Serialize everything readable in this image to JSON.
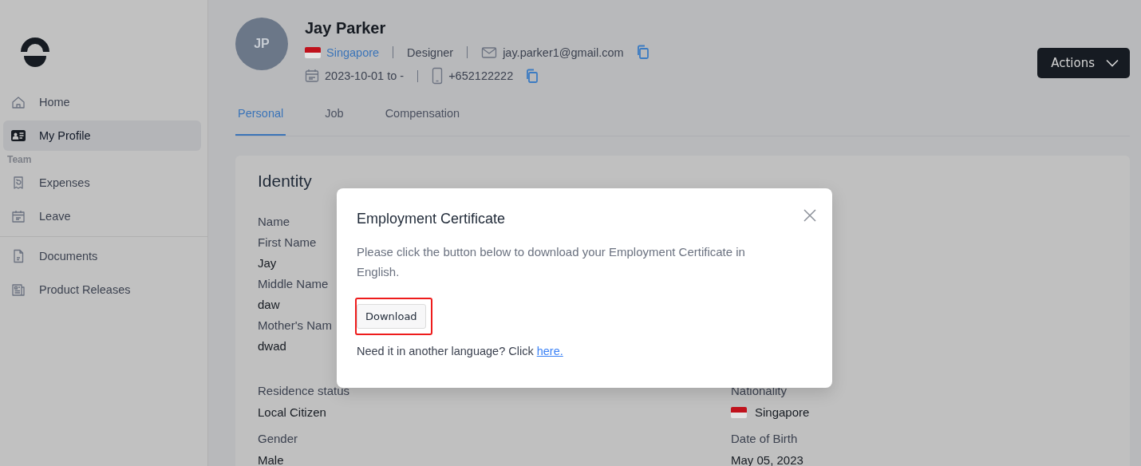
{
  "sidebar": {
    "groups": [
      {
        "items": [
          {
            "label": "Home",
            "selected": false
          },
          {
            "label": "My Profile",
            "selected": true
          }
        ]
      },
      {
        "heading": "Team",
        "items": [
          {
            "label": "Expenses",
            "selected": false
          },
          {
            "label": "Leave",
            "selected": false
          }
        ]
      },
      {
        "items": [
          {
            "label": "Documents",
            "selected": false
          },
          {
            "label": "Product Releases",
            "selected": false
          }
        ]
      }
    ]
  },
  "profile": {
    "initials": "JP",
    "name": "Jay Parker",
    "country": "Singapore",
    "role": "Designer",
    "email": "jay.parker1@gmail.com",
    "dates": "2023-10-01 to -",
    "phone": "+652122222"
  },
  "actions_button": "Actions",
  "tabs": [
    {
      "label": "Personal",
      "selected": true
    },
    {
      "label": "Job",
      "selected": false
    },
    {
      "label": "Compensation",
      "selected": false
    }
  ],
  "card": {
    "title": "Identity",
    "section": "Name",
    "left": [
      {
        "label": "First Name",
        "value": "Jay"
      },
      {
        "label": "Middle Name",
        "value": "daw"
      },
      {
        "label": "Mother's Nam",
        "value": "dwad"
      }
    ],
    "rows": [
      [
        {
          "kind": "text",
          "label": "Residence status",
          "value": "Local Citizen"
        },
        {
          "kind": "country",
          "label": "Nationality",
          "value": "Singapore"
        }
      ],
      [
        {
          "kind": "text",
          "label": "Gender",
          "value": "Male"
        },
        {
          "kind": "text",
          "label": "Date of Birth",
          "value": "May 05, 2023"
        }
      ]
    ]
  },
  "modal": {
    "title": "Employment Certificate",
    "body": "Please click the button below to download your Employment Certificate in English.",
    "button": "Download",
    "footer_text": "Need it in another language? Click",
    "footer_link": "here."
  }
}
